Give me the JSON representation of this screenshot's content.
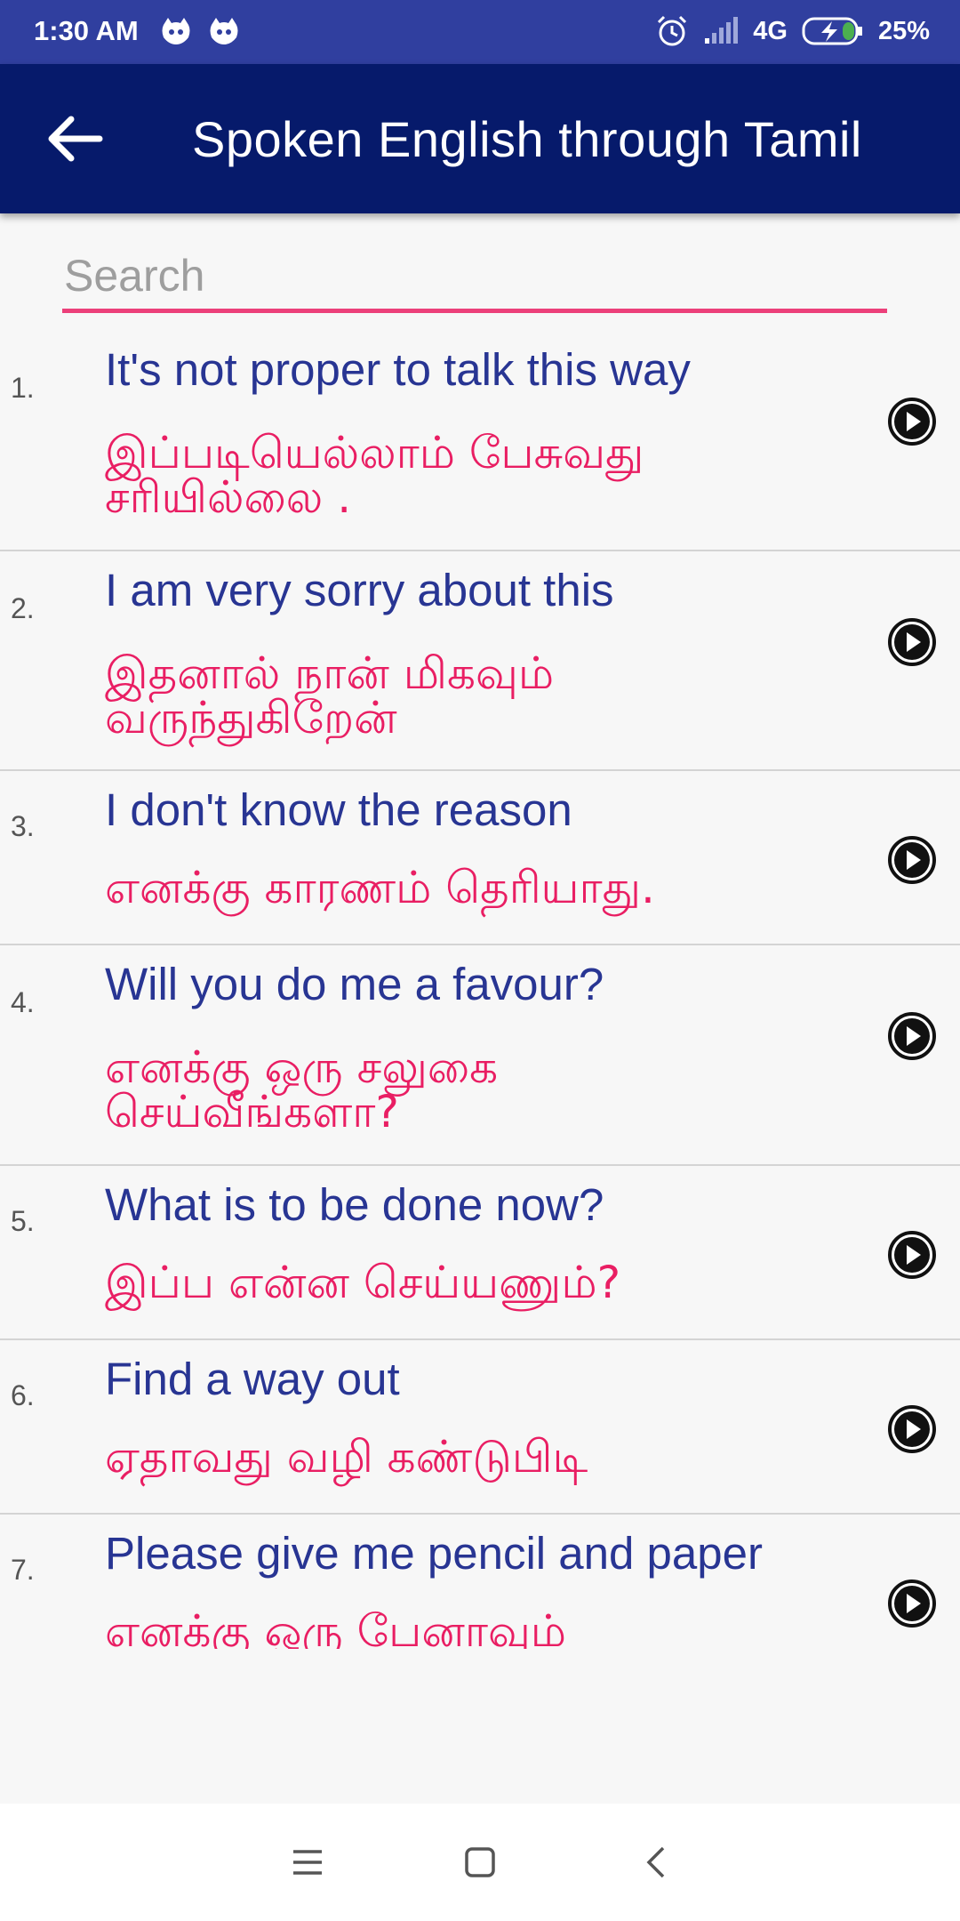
{
  "status_bar": {
    "time": "1:30 AM",
    "network": "4G",
    "battery": "25%",
    "icons": [
      "notification-app-icon",
      "notification-app-icon",
      "alarm-icon",
      "signal-icon",
      "battery-charging-icon"
    ]
  },
  "app_bar": {
    "title": "Spoken English through Tamil",
    "back_icon": "arrow-left-icon",
    "color": "#061a6b"
  },
  "search": {
    "placeholder": "Search",
    "value": "",
    "accent": "#ec407a"
  },
  "phrases": [
    {
      "num": "1.",
      "english": "It's not proper to talk this way",
      "tamil": "இப்படியெல்லாம் பேசுவது சரியில்லை ."
    },
    {
      "num": "2.",
      "english": "I am very sorry about this",
      "tamil": "இதனால் நான் மிகவும் வருந்துகிறேன்"
    },
    {
      "num": "3.",
      "english": "I don't know the reason",
      "tamil": "எனக்கு காரணம் தெரியாது."
    },
    {
      "num": "4.",
      "english": "Will you do me a favour?",
      "tamil": "எனக்கு ஒரு சலுகை செய்வீங்களா?"
    },
    {
      "num": "5.",
      "english": "What is to be done now?",
      "tamil": "இப்ப என்ன செய்யணும்?"
    },
    {
      "num": "6.",
      "english": "Find a way out",
      "tamil": "ஏதாவது வழி கண்டுபிடி"
    },
    {
      "num": "7.",
      "english": "Please give me pencil and paper",
      "tamil": "எனக்கு ஒரு பேனாவும்"
    }
  ],
  "colors": {
    "english_text": "#283593",
    "tamil_text": "#e91e63",
    "status_bar": "#303f9f"
  },
  "nav_bar": {
    "icons": [
      "menu-icon",
      "home-square-icon",
      "back-chevron-icon"
    ]
  }
}
